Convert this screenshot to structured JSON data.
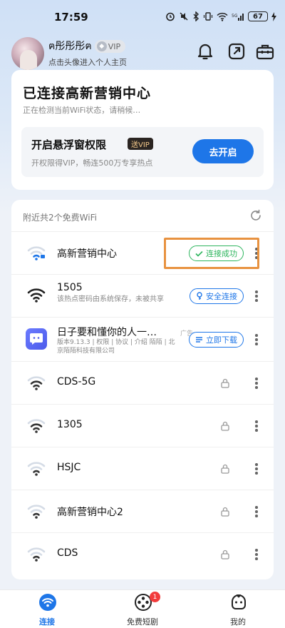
{
  "status_bar": {
    "time": "17:59",
    "battery": "67"
  },
  "header": {
    "username": "ฅ彤彤彤ฅ",
    "vip_label": "VIP",
    "profile_hint": "点击头像进入个人主页",
    "icons": [
      "bell-icon",
      "share-icon",
      "toolbox-icon"
    ]
  },
  "connected_card": {
    "title": "已连接高新营销中心",
    "subtitle": "正在检测当前WiFi状态，请稍候…",
    "float_window": {
      "title": "开启悬浮窗权限",
      "vip_tag": "送VIP",
      "subtitle": "开权限得VIP，畅连500万专享热点",
      "button_label": "去开启"
    }
  },
  "wifi_list": {
    "header": "附近共2个免费WiFi",
    "networks": [
      {
        "name": "高新营销中心",
        "status_button": "连接成功",
        "colors": {
          "status": "#2DB55D"
        }
      },
      {
        "name": "1505",
        "desc": "该热点密码由系统保存，未被共享",
        "action_button": "安全连接"
      },
      {
        "name": "日子要和懂你的人一…",
        "ad_label": "广告",
        "desc": "版本9.13.3 | 权限 | 协议 | 介绍 陌陌 | 北京陌陌科技有限公司",
        "action_button": "立即下载"
      },
      {
        "name": "CDS-5G"
      },
      {
        "name": "1305"
      },
      {
        "name": "HSJC"
      },
      {
        "name": "高新营销中心2"
      },
      {
        "name": "CDS"
      }
    ]
  },
  "bottom_nav": {
    "items": [
      {
        "label": "连接",
        "icon": "wifi-icon"
      },
      {
        "label": "免费短剧",
        "icon": "film-reel-icon",
        "badge": "1"
      },
      {
        "label": "我的",
        "icon": "profile-face-icon"
      }
    ]
  },
  "colors": {
    "accent": "#1E76E8",
    "success": "#2DB55D",
    "highlight": "#E89240"
  }
}
